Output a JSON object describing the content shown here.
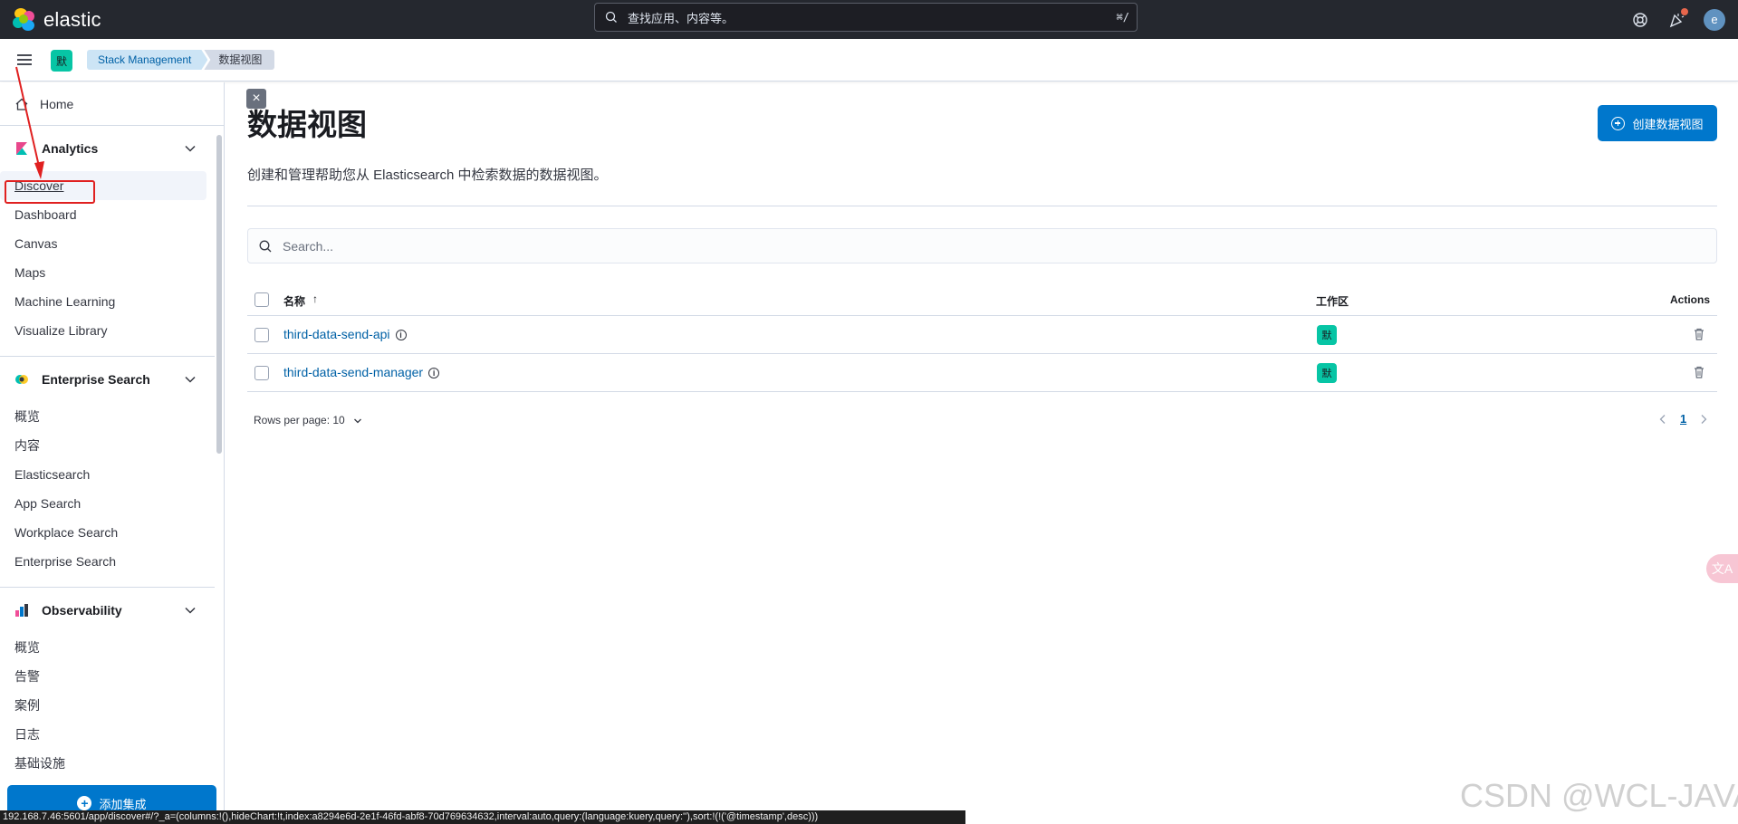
{
  "header": {
    "logo_text": "elastic",
    "search_placeholder": "查找应用、内容等。",
    "search_shortcut": "⌘/",
    "user_initial": "e"
  },
  "subbar": {
    "space_initial": "默",
    "breadcrumbs": [
      "Stack Management",
      "数据视图"
    ]
  },
  "sidebar": {
    "home": "Home",
    "groups": [
      {
        "title": "Analytics",
        "items": [
          "Discover",
          "Dashboard",
          "Canvas",
          "Maps",
          "Machine Learning",
          "Visualize Library"
        ]
      },
      {
        "title": "Enterprise Search",
        "items": [
          "概览",
          "内容",
          "Elasticsearch",
          "App Search",
          "Workplace Search",
          "Enterprise Search"
        ]
      },
      {
        "title": "Observability",
        "items": [
          "概览",
          "告警",
          "案例",
          "日志",
          "基础设施"
        ]
      }
    ],
    "add_integrations": "添加集成"
  },
  "main": {
    "title": "数据视图",
    "description": "创建和管理帮助您从 Elasticsearch 中检索数据的数据视图。",
    "create_button": "创建数据视图",
    "search_placeholder": "Search...",
    "table": {
      "columns": [
        "名称",
        "工作区",
        "Actions"
      ],
      "sort_indicator": "↑",
      "rows": [
        {
          "name": "third-data-send-api",
          "space": "默"
        },
        {
          "name": "third-data-send-manager",
          "space": "默"
        }
      ]
    },
    "rows_per_page": "Rows per page: 10",
    "current_page": "1"
  },
  "status_bar": "192.168.7.46:5601/app/discover#/?_a=(columns:!(),hideChart:!t,index:a8294e6d-2e1f-46fd-abf8-70d769634632,interval:auto,query:(language:kuery,query:''),sort:!(!('@timestamp',desc)))",
  "watermark": "CSDN @WCL-JAVA",
  "side_widget": "文A",
  "colors": {
    "header_bg": "#25282f",
    "primary": "#0077cc",
    "link": "#0061a6",
    "space_badge": "#07c5a5",
    "annotation": "#e02020"
  }
}
